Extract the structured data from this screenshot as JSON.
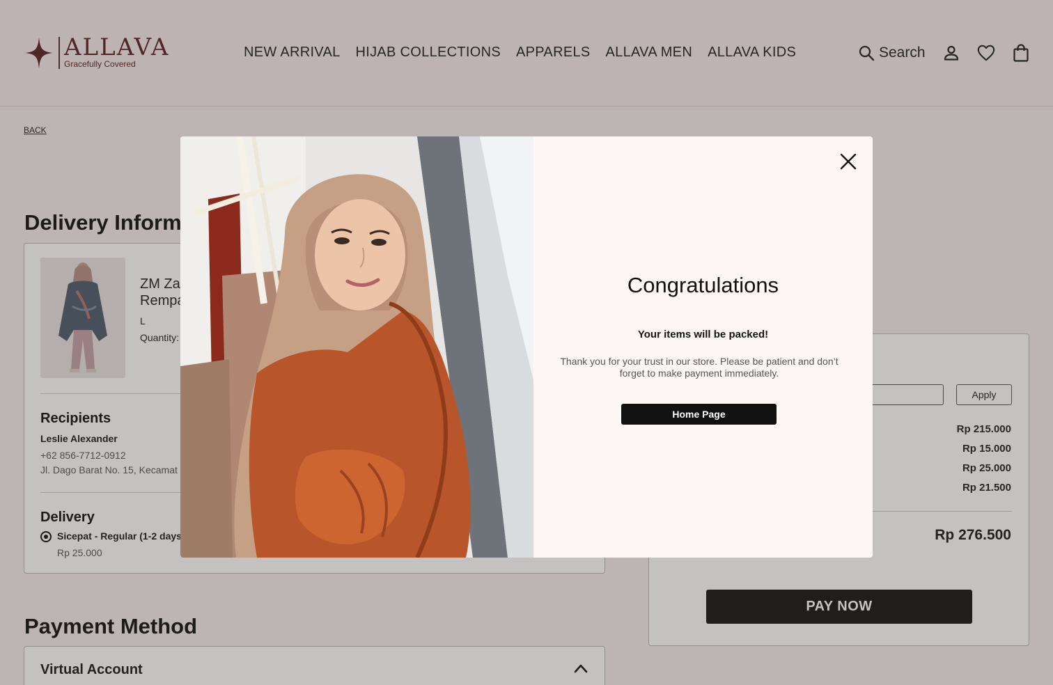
{
  "header": {
    "brand_name": "ALLAVA",
    "brand_tagline": "Gracefully Covered",
    "nav": [
      "NEW ARRIVAL",
      "HIJAB COLLECTIONS",
      "APPARELS",
      "ALLAVA MEN",
      "ALLAVA KIDS"
    ],
    "search_label": "Search"
  },
  "page": {
    "back_label": "BACK",
    "delivery_title": "Delivery Informa",
    "product": {
      "name": "ZM Za\nRempa",
      "size": "L",
      "quantity_label": "Quantity:"
    },
    "recipients": {
      "title": "Recipients",
      "name": "Leslie Alexander",
      "phone": "+62 856-7712-0912",
      "address": "Jl. Dago Barat No. 15, Kecamat"
    },
    "delivery": {
      "title": "Delivery",
      "option": "Sicepat - Regular (1-2 days",
      "price": "Rp 25.000"
    },
    "payment_title": "Payment Method",
    "payment_option": "Virtual Account"
  },
  "summary": {
    "apply_label": "Apply",
    "prices": [
      "Rp 215.000",
      "Rp 15.000",
      "Rp 25.000",
      "Rp 21.500"
    ],
    "total": "Rp 276.500",
    "pay_label": "PAY NOW"
  },
  "modal": {
    "title": "Congratulations",
    "subtitle": "Your items will be packed!",
    "body": "Thank you for your trust in our store. Please be patient and don’t forget to make payment immediately.",
    "button_label": "Home Page"
  },
  "colors": {
    "brand": "#5a2226",
    "header_bg": "#f5ebeb",
    "button_bg": "#151515",
    "modal_bg": "#fdf7f6"
  }
}
